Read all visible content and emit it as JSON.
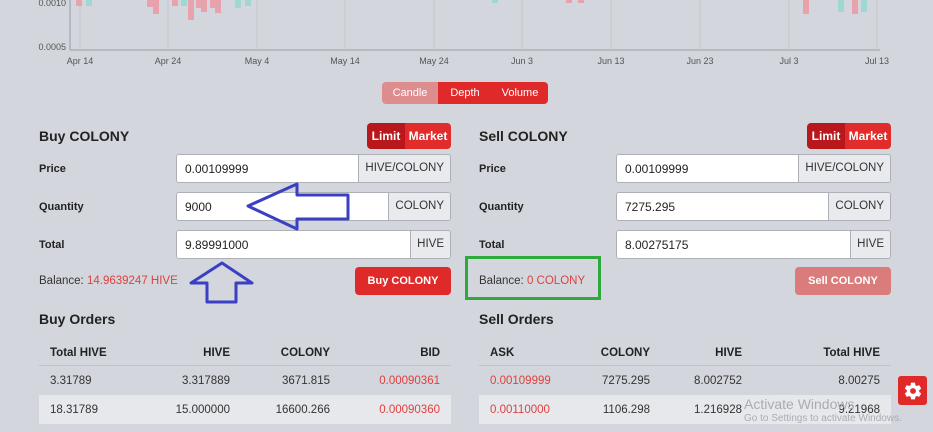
{
  "chart": {
    "y_ticks": [
      "0.0010",
      "0.0005"
    ],
    "x_ticks": [
      "Apr 14",
      "Apr 24",
      "May 4",
      "May 14",
      "May 24",
      "Jun 3",
      "Jun 13",
      "Jun 23",
      "Jul 3",
      "Jul 13"
    ]
  },
  "chart_tabs": {
    "candle": "Candle",
    "depth": "Depth",
    "volume": "Volume"
  },
  "buy": {
    "title": "Buy COLONY",
    "limit_label": "Limit",
    "market_label": "Market",
    "price_label": "Price",
    "price_value": "0.00109999",
    "price_unit": "HIVE/COLONY",
    "quantity_label": "Quantity",
    "quantity_value": "9000",
    "quantity_unit": "COLONY",
    "total_label": "Total",
    "total_value": "9.89991000",
    "total_unit": "HIVE",
    "balance_label": "Balance:",
    "balance_value": "14.9639247 HIVE",
    "button_label": "Buy COLONY"
  },
  "sell": {
    "title": "Sell COLONY",
    "limit_label": "Limit",
    "market_label": "Market",
    "price_label": "Price",
    "price_value": "0.00109999",
    "price_unit": "HIVE/COLONY",
    "quantity_label": "Quantity",
    "quantity_value": "7275.295",
    "quantity_unit": "COLONY",
    "total_label": "Total",
    "total_value": "8.00275175",
    "total_unit": "HIVE",
    "balance_label": "Balance:",
    "balance_value": "0 COLONY",
    "button_label": "Sell COLONY"
  },
  "buy_orders": {
    "title": "Buy Orders",
    "headers": [
      "Total HIVE",
      "HIVE",
      "COLONY",
      "BID"
    ],
    "rows": [
      [
        "3.31789",
        "3.317889",
        "3671.815",
        "0.00090361"
      ],
      [
        "18.31789",
        "15.000000",
        "16600.266",
        "0.00090360"
      ]
    ]
  },
  "sell_orders": {
    "title": "Sell Orders",
    "headers": [
      "ASK",
      "COLONY",
      "HIVE",
      "Total HIVE"
    ],
    "rows": [
      [
        "0.00109999",
        "7275.295",
        "8.002752",
        "8.00275"
      ],
      [
        "0.00110000",
        "1106.298",
        "1.216928",
        "9.21968"
      ]
    ]
  },
  "watermark": {
    "line1": "Activate Windows",
    "line2": "Go to Settings to activate Windows."
  },
  "colors": {
    "accent": "#e02a2a",
    "accent_dark": "#b8171c",
    "accent_light": "#de8d8f",
    "annotation_green": "#2eaa3c",
    "annotation_blue": "#3a3fc4",
    "background": "#d3d6dc"
  },
  "icons": {
    "settings": "gear-icon"
  }
}
